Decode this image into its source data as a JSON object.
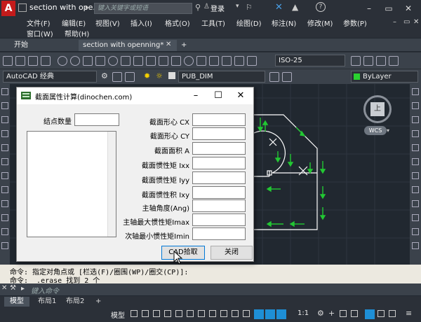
{
  "app": {
    "logo": "A",
    "title": "section with ope...",
    "search_placeholder": "键入关键字或短语",
    "login": "登录"
  },
  "menu": {
    "row1": [
      "文件(F)",
      "编辑(E)",
      "视图(V)",
      "插入(I)",
      "格式(O)",
      "工具(T)",
      "绘图(D)",
      "标注(N)",
      "修改(M)",
      "参数(P)"
    ],
    "row2": [
      "窗口(W)",
      "帮助(H)"
    ]
  },
  "file_tabs": [
    "开始",
    "section with openning*",
    "+"
  ],
  "toolbar": {
    "dimstyle": "ISO-25",
    "workspace": "AutoCAD 经典",
    "layer": "PUB_DIM",
    "color": "ByLayer"
  },
  "viewcube": {
    "face": "上",
    "wcs": "WCS"
  },
  "dialog": {
    "title": "截面属性计算(dinochen.com)",
    "node_count_label": "结点数量",
    "fields": [
      {
        "label": "截面形心 CX",
        "value": ""
      },
      {
        "label": "截面形心 CY",
        "value": ""
      },
      {
        "label": "截面面积 A",
        "value": ""
      },
      {
        "label": "截面惯性矩 Ixx",
        "value": ""
      },
      {
        "label": "截面惯性矩 Iyy",
        "value": ""
      },
      {
        "label": "截面惯性积 Ixy",
        "value": ""
      },
      {
        "label": "主轴角度(Ang)",
        "value": ""
      },
      {
        "label": "主轴最大惯性矩Imax",
        "value": ""
      },
      {
        "label": "次轴最小惯性矩Imin",
        "value": ""
      }
    ],
    "cad_pick": "CAD拾取",
    "close": "关闭"
  },
  "command": {
    "line1": "命令: 指定对角点或 [栏选(F)/圈围(WP)/圈交(CP)]:",
    "line2": "命令: _.erase 找到 2 个",
    "input_placeholder": "键入命令"
  },
  "layout_tabs": [
    "模型",
    "布局1",
    "布局2",
    "+"
  ],
  "status": {
    "model": "模型",
    "scale": "1:1"
  },
  "colors": {
    "accent": "#1e8fd6",
    "logo_red": "#c41b1b",
    "arrow_green": "#22c833",
    "geom": "#ffffff"
  }
}
